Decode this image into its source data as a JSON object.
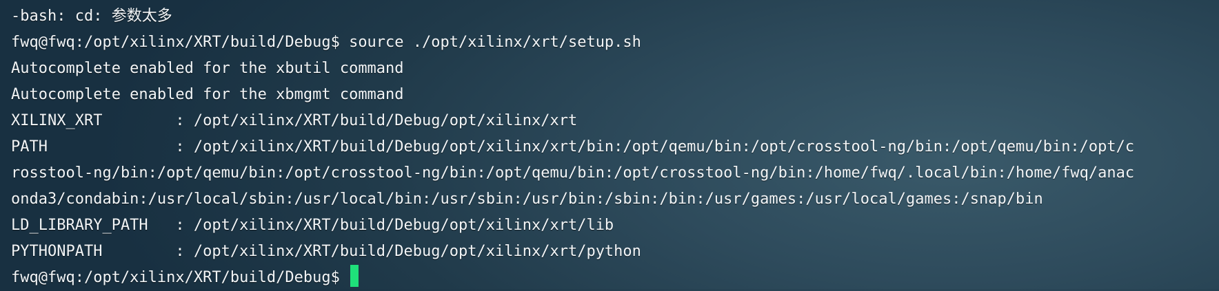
{
  "terminal": {
    "lines": [
      "-bash: cd: 参数太多",
      "fwq@fwq:/opt/xilinx/XRT/build/Debug$ source ./opt/xilinx/xrt/setup.sh",
      "Autocomplete enabled for the xbutil command",
      "Autocomplete enabled for the xbmgmt command",
      "XILINX_XRT        : /opt/xilinx/XRT/build/Debug/opt/xilinx/xrt",
      "PATH              : /opt/xilinx/XRT/build/Debug/opt/xilinx/xrt/bin:/opt/qemu/bin:/opt/crosstool-ng/bin:/opt/qemu/bin:/opt/c",
      "rosstool-ng/bin:/opt/qemu/bin:/opt/crosstool-ng/bin:/opt/qemu/bin:/opt/crosstool-ng/bin:/home/fwq/.local/bin:/home/fwq/anac",
      "onda3/condabin:/usr/local/sbin:/usr/local/bin:/usr/sbin:/usr/bin:/sbin:/bin:/usr/games:/usr/local/games:/snap/bin",
      "LD_LIBRARY_PATH   : /opt/xilinx/XRT/build/Debug/opt/xilinx/xrt/lib",
      "PYTHONPATH        : /opt/xilinx/XRT/build/Debug/opt/xilinx/xrt/python"
    ],
    "prompt": "fwq@fwq:/opt/xilinx/XRT/build/Debug$ ",
    "cursor_color": "#1fe07a",
    "text_color": "#f2f5f7"
  }
}
